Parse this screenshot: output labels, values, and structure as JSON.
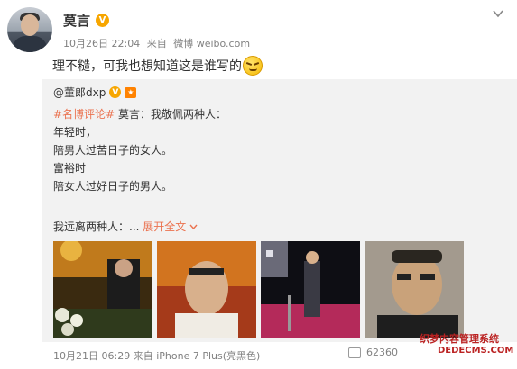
{
  "post": {
    "author": "莫言",
    "verified_badge": "V",
    "time": "10月26日 22:04",
    "source_prefix": "来自",
    "source": "微博 weibo.com",
    "text": "理不糙，可我也想知道这是谁写的",
    "emoji": "doge-emoji"
  },
  "repost": {
    "author": "@董郎dxp",
    "verified_badge": "V",
    "topic": "#名博评论#",
    "lead": "莫言：我敬佩两种人：",
    "lines": [
      "年轻时，",
      "陪男人过苦日子的女人。",
      "富裕时",
      "陪女人过好日子的男人。"
    ],
    "last_line": "我远离两种人：...",
    "expand_label": "展开全文",
    "footer_time": "10月21日 06:29",
    "footer_source_prefix": "来自",
    "footer_source": "iPhone 7 Plus(亮黑色)",
    "repost_count": "62360"
  },
  "watermark": {
    "line1": "织梦内容管理系统",
    "line2": "DEDECMS.COM"
  },
  "colors": {
    "accent": "#eb7350",
    "meta": "#808080",
    "repost_bg": "#f2f2f2",
    "badge": "#f7a600"
  }
}
